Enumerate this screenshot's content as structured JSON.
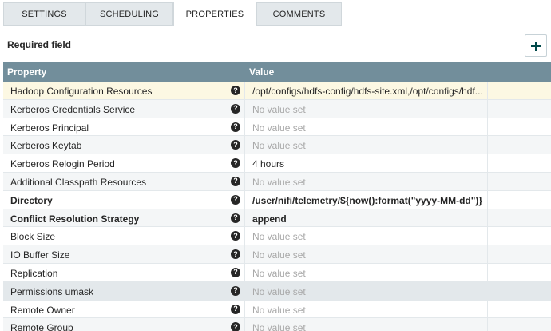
{
  "tabs": [
    {
      "label": "SETTINGS",
      "active": false
    },
    {
      "label": "SCHEDULING",
      "active": false
    },
    {
      "label": "PROPERTIES",
      "active": true
    },
    {
      "label": "COMMENTS",
      "active": false
    }
  ],
  "required_field_label": "Required field",
  "add_button_icon": "plus-icon",
  "table": {
    "headers": {
      "property": "Property",
      "value": "Value"
    },
    "rows": [
      {
        "name": "Hadoop Configuration Resources",
        "value": "/opt/configs/hdfs-config/hdfs-site.xml,/opt/configs/hdf...",
        "required": false,
        "empty": false
      },
      {
        "name": "Kerberos Credentials Service",
        "value": "No value set",
        "required": false,
        "empty": true
      },
      {
        "name": "Kerberos Principal",
        "value": "No value set",
        "required": false,
        "empty": true
      },
      {
        "name": "Kerberos Keytab",
        "value": "No value set",
        "required": false,
        "empty": true
      },
      {
        "name": "Kerberos Relogin Period",
        "value": "4 hours",
        "required": false,
        "empty": false
      },
      {
        "name": "Additional Classpath Resources",
        "value": "No value set",
        "required": false,
        "empty": true
      },
      {
        "name": "Directory",
        "value": "/user/nifi/telemetry/${now():format(\"yyyy-MM-dd\")}",
        "required": true,
        "empty": false
      },
      {
        "name": "Conflict Resolution Strategy",
        "value": "append",
        "required": true,
        "empty": false
      },
      {
        "name": "Block Size",
        "value": "No value set",
        "required": false,
        "empty": true
      },
      {
        "name": "IO Buffer Size",
        "value": "No value set",
        "required": false,
        "empty": true
      },
      {
        "name": "Replication",
        "value": "No value set",
        "required": false,
        "empty": true
      },
      {
        "name": "Permissions umask",
        "value": "No value set",
        "required": false,
        "empty": true
      },
      {
        "name": "Remote Owner",
        "value": "No value set",
        "required": false,
        "empty": true
      },
      {
        "name": "Remote Group",
        "value": "No value set",
        "required": false,
        "empty": true
      }
    ]
  },
  "help_icon_glyph": "?",
  "colors": {
    "header_bg": "#728e9b",
    "selected_row": "#fcf8e3",
    "hover_row": "#e3e8eb",
    "empty_text": "#a8a8a8",
    "accent": "#004849"
  }
}
